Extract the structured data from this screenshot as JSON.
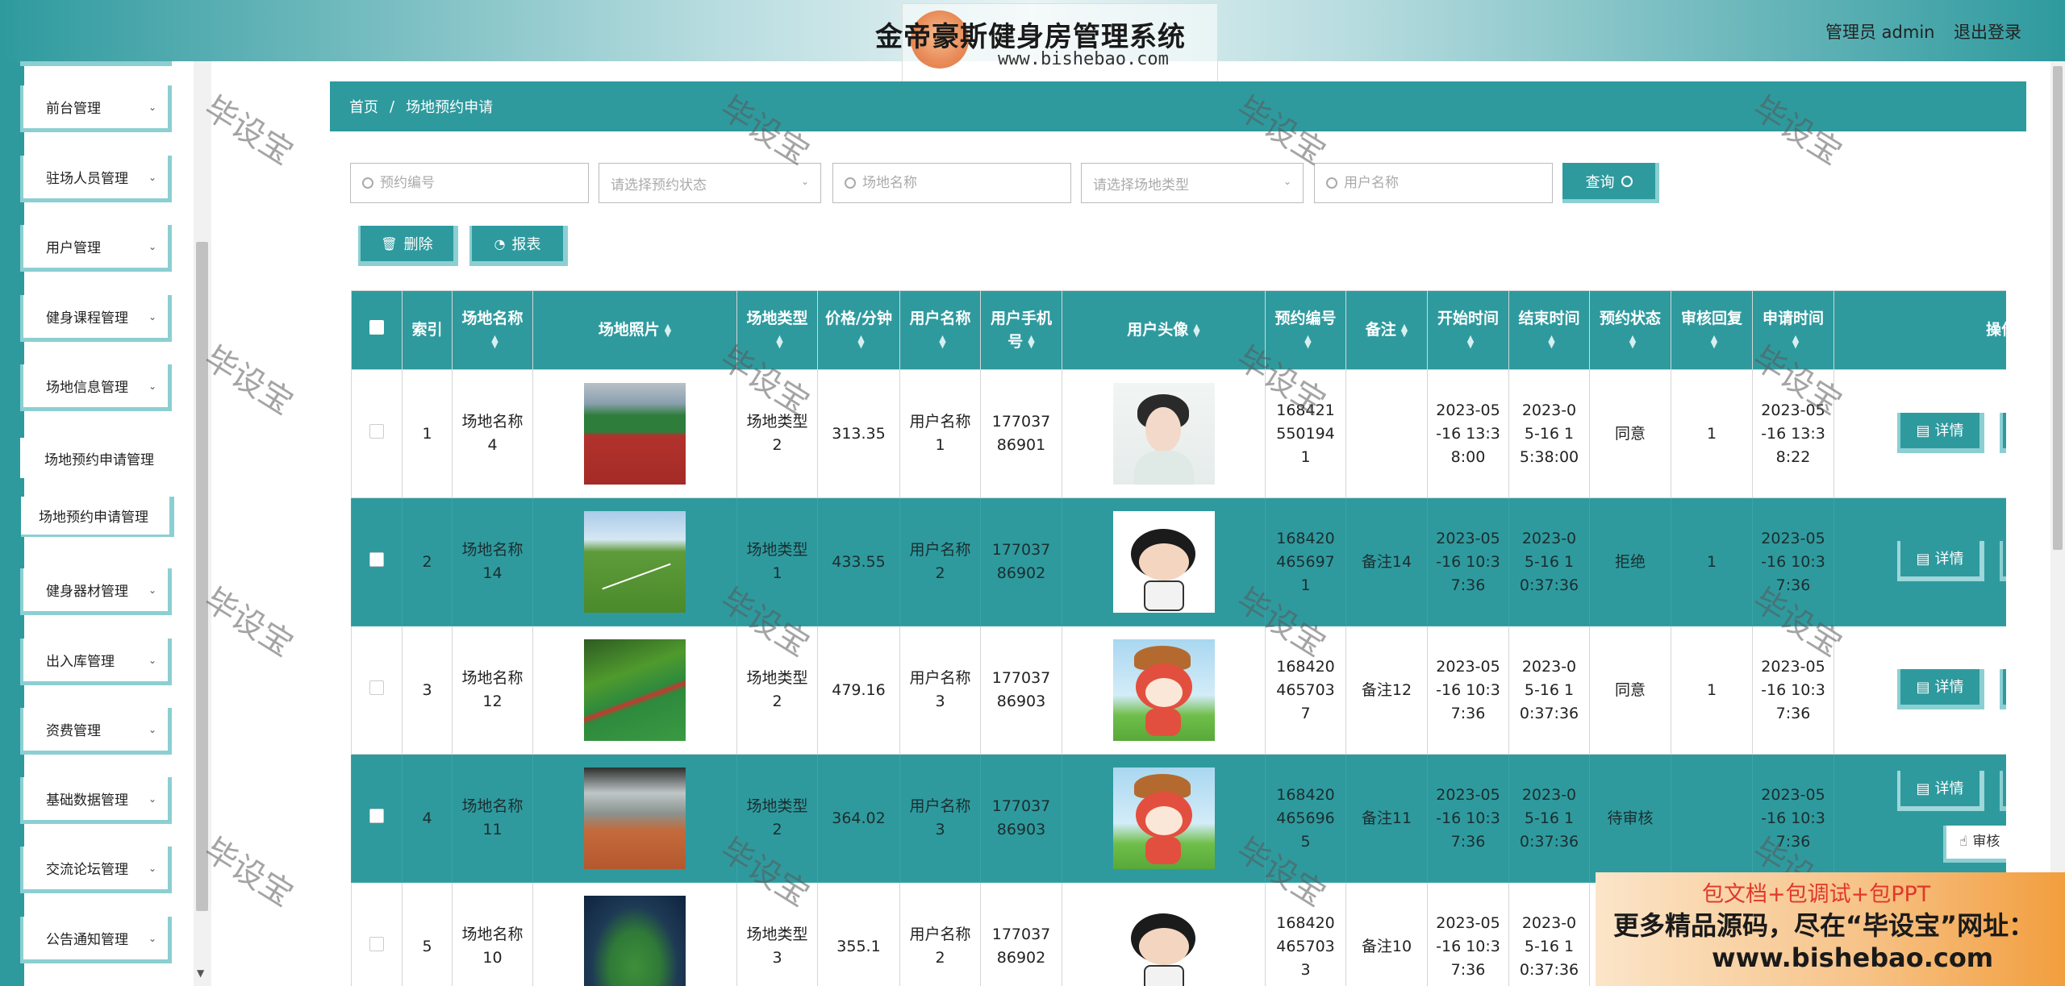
{
  "header": {
    "title": "金帝豪斯健身房管理系统",
    "logo_url_text": "www.bishebao.com",
    "admin_label": "管理员 admin",
    "logout_label": "退出登录"
  },
  "sidebar": {
    "items": [
      {
        "label": "前台管理"
      },
      {
        "label": "驻场人员管理"
      },
      {
        "label": "用户管理"
      },
      {
        "label": "健身课程管理"
      },
      {
        "label": "场地信息管理"
      }
    ],
    "sub_item": "场地预约申请管理",
    "active_item": "场地预约申请管理",
    "items_after": [
      {
        "label": "健身器材管理"
      },
      {
        "label": "出入库管理"
      },
      {
        "label": "资费管理"
      },
      {
        "label": "基础数据管理"
      },
      {
        "label": "交流论坛管理"
      },
      {
        "label": "公告通知管理"
      }
    ]
  },
  "breadcrumb": {
    "home": "首页",
    "separator": "/",
    "current": "场地预约申请"
  },
  "search": {
    "booking_no_placeholder": "预约编号",
    "status_placeholder": "请选择预约状态",
    "venue_name_placeholder": "场地名称",
    "venue_type_placeholder": "请选择场地类型",
    "user_name_placeholder": "用户名称",
    "query_label": "查询"
  },
  "actions": {
    "delete_label": "删除",
    "report_label": "报表"
  },
  "table": {
    "headers": {
      "index": "索引",
      "venue_name": "场地名称",
      "venue_photo": "场地照片",
      "venue_type": "场地类型",
      "price": "价格/分钟",
      "user_name": "用户名称",
      "phone": "用户手机号",
      "avatar": "用户头像",
      "booking_no": "预约编号",
      "remark": "备注",
      "start": "开始时间",
      "end": "结束时间",
      "status": "预约状态",
      "review": "审核回复",
      "apply_time": "申请时间",
      "ops": "操作"
    },
    "rows": [
      {
        "index": "1",
        "venue_name": "场地名称4",
        "photo": "track",
        "venue_type": "场地类型2",
        "price": "313.35",
        "user_name": "用户名称1",
        "phone": "17703786901",
        "avatar": "girl",
        "booking_no": "1684215501941",
        "remark": "",
        "start": "2023-05-16 13:38:00",
        "end": "2023-05-16 15:38:00",
        "status": "同意",
        "review": "1",
        "apply_time": "2023-05-16 13:38:22",
        "detail_label": "详情"
      },
      {
        "index": "2",
        "venue_name": "场地名称14",
        "photo": "field",
        "venue_type": "场地类型1",
        "price": "433.55",
        "user_name": "用户名称2",
        "phone": "17703786902",
        "avatar": "boy",
        "booking_no": "1684204656971",
        "remark": "备注14",
        "start": "2023-05-16 10:37:36",
        "end": "2023-05-16 10:37:36",
        "status": "拒绝",
        "review": "1",
        "apply_time": "2023-05-16 10:37:36",
        "detail_label": "详情"
      },
      {
        "index": "3",
        "venue_name": "场地名称12",
        "photo": "track2",
        "venue_type": "场地类型2",
        "price": "479.16",
        "user_name": "用户名称3",
        "phone": "17703786903",
        "avatar": "fox",
        "booking_no": "1684204657037",
        "remark": "备注12",
        "start": "2023-05-16 10:37:36",
        "end": "2023-05-16 10:37:36",
        "status": "同意",
        "review": "1",
        "apply_time": "2023-05-16 10:37:36",
        "detail_label": "详情"
      },
      {
        "index": "4",
        "venue_name": "场地名称11",
        "photo": "tennis",
        "venue_type": "场地类型2",
        "price": "364.02",
        "user_name": "用户名称3",
        "phone": "17703786903",
        "avatar": "fox",
        "booking_no": "1684204656965",
        "remark": "备注11",
        "start": "2023-05-16 10:37:36",
        "end": "2023-05-16 10:37:36",
        "status": "待审核",
        "review": "",
        "apply_time": "2023-05-16 10:37:36",
        "detail_label": "详情",
        "review_label": "审核"
      },
      {
        "index": "5",
        "venue_name": "场地名称10",
        "photo": "stadium",
        "venue_type": "场地类型3",
        "price": "355.1",
        "user_name": "用户名称2",
        "phone": "17703786902",
        "avatar": "boy",
        "booking_no": "1684204657033",
        "remark": "备注10",
        "start": "2023-05-16 10:37:36",
        "end": "2023-05-16 10:37:36",
        "status": "",
        "review": "",
        "apply_time": "",
        "detail_label": ""
      }
    ]
  },
  "watermark": "毕设宝",
  "promo": {
    "line1": "包文档+包调试+包PPT",
    "line2": "更多精品源码，尽在“毕设宝”网址：",
    "line3": "www.bishebao.com"
  },
  "colors": {
    "primary": "#2e9a9e",
    "accent_border": "#8ccfd2"
  }
}
